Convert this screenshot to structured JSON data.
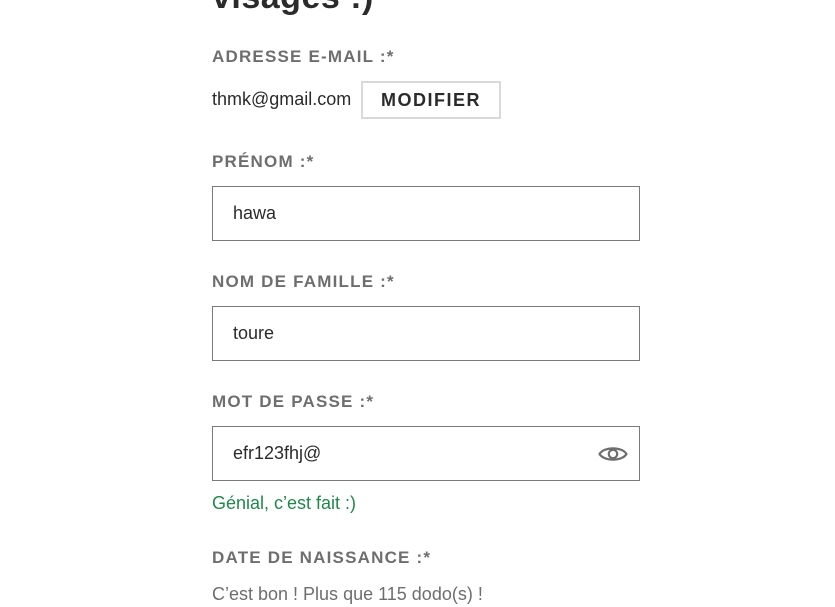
{
  "form": {
    "heading": "visages :)",
    "email": {
      "label": "ADRESSE E-MAIL :*",
      "value": "thmk@gmail.com",
      "modify_label": "MODIFIER"
    },
    "first_name": {
      "label": "PRÉNOM :*",
      "value": "hawa"
    },
    "last_name": {
      "label": "NOM DE FAMILLE :*",
      "value": "toure"
    },
    "password": {
      "label": "MOT DE PASSE :*",
      "value": "efr123fhj@",
      "toggle_icon": "eye-icon",
      "success_message": "Génial, c’est fait :)",
      "success_color": "#1e8a4a"
    },
    "birth_date": {
      "label": "DATE DE NAISSANCE :*",
      "note": "C’est bon ! Plus que 115 dodo(s) !"
    }
  }
}
